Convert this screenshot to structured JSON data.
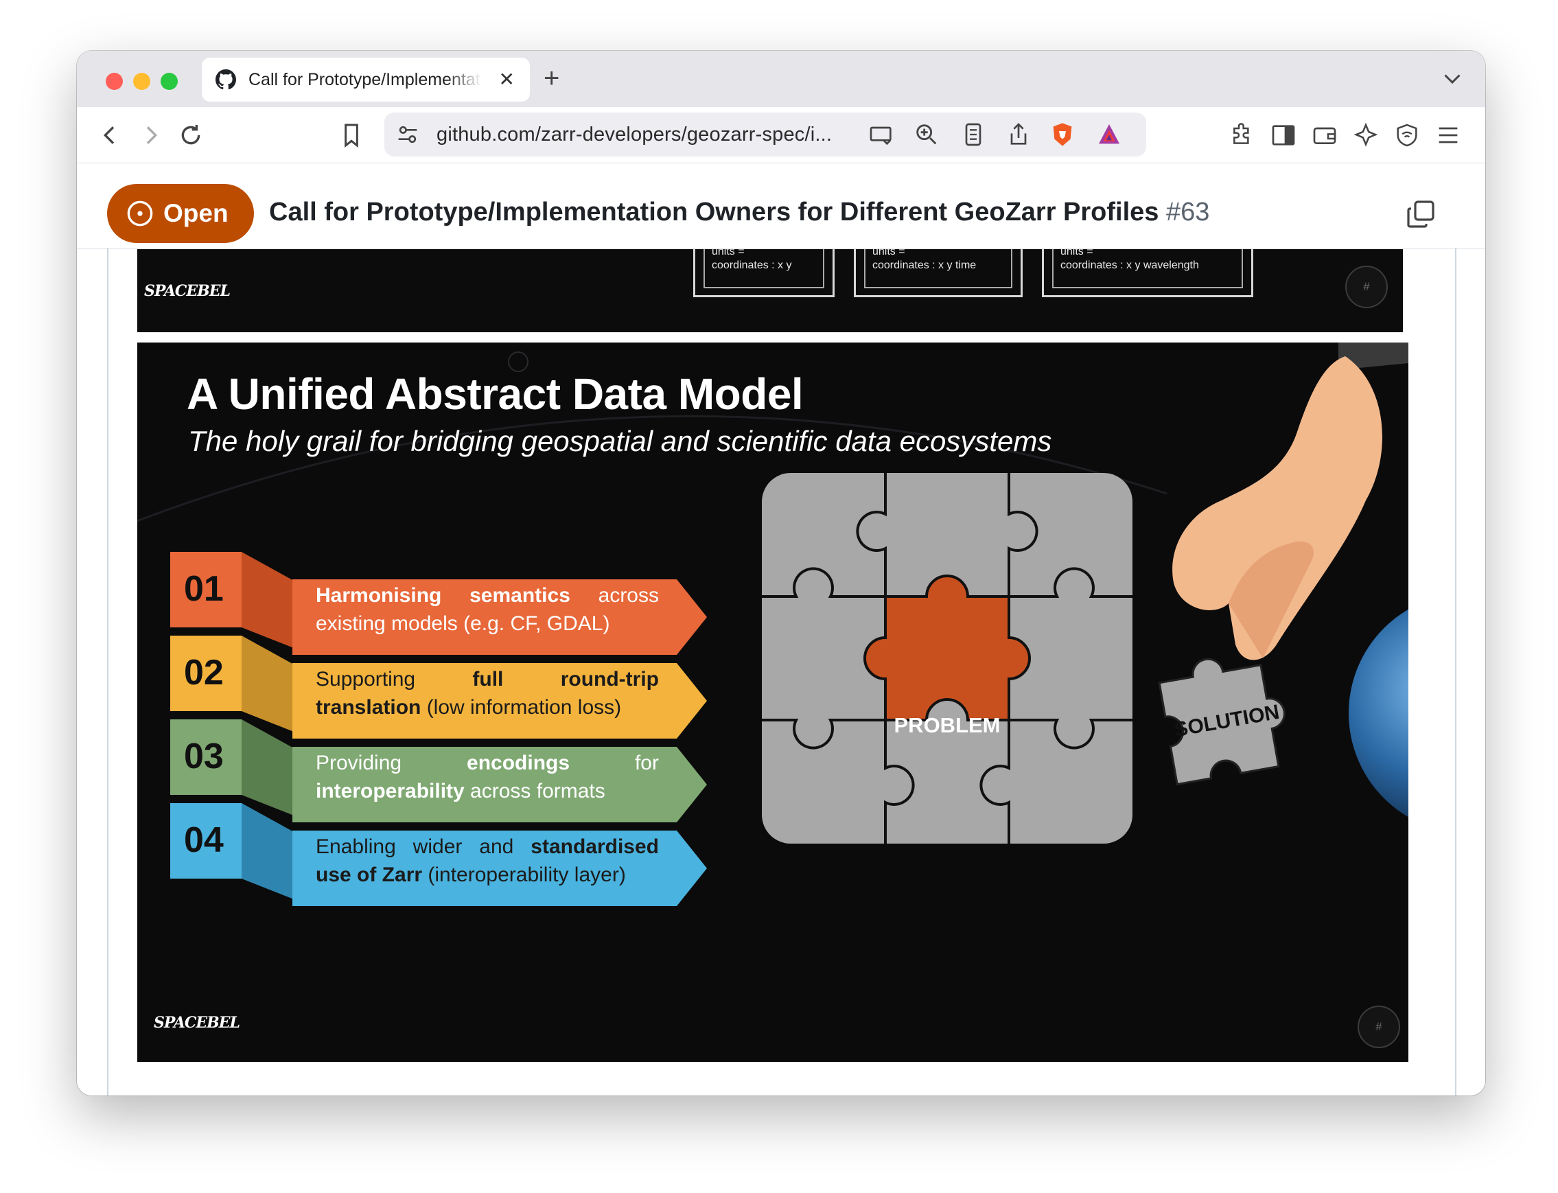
{
  "browser": {
    "tab_title": "Call for Prototype/Implementation Owners for Different GeoZarr Profiles",
    "tab_close": "✕",
    "new_tab": "+",
    "url": "github.com/zarr-developers/geozarr-spec/i...",
    "icons": [
      "back-icon",
      "forward-icon",
      "reload-icon",
      "bookmark-icon",
      "site-settings-icon",
      "cast-icon",
      "zoom-icon",
      "reader-icon",
      "share-icon",
      "brave-shields-icon",
      "brave-rewards-icon",
      "extensions-icon",
      "sidebar-icon",
      "wallet-icon",
      "leo-ai-icon",
      "vpn-icon",
      "menu-icon"
    ]
  },
  "issue": {
    "state": "Open",
    "title": "Call for Prototype/Implementation Owners for Different GeoZarr Profiles",
    "number": "#63"
  },
  "prev_slide": {
    "boxes": [
      {
        "line1": "units =",
        "line2": "coordinates : x y"
      },
      {
        "line1": "units =",
        "line2": "coordinates : x y time"
      },
      {
        "line1": "units =",
        "line2": "coordinates : x y wavelength"
      }
    ],
    "logo": "SPACEBEL",
    "page_num": "#"
  },
  "slide": {
    "title": "A Unified Abstract Data Model",
    "subtitle": "The holy grail for bridging geospatial and scientific data ecosystems",
    "items": [
      {
        "num": "01",
        "bold1": "Harmonising",
        "bold2": "semantics",
        "text1": " across existing models (e.g. CF, GDAL)",
        "color": "#e8683a"
      },
      {
        "num": "02",
        "text0": "Supporting ",
        "bold1": "full",
        "bold2": "round-trip translation",
        "text1": " (low information loss)",
        "color": "#f3b33d"
      },
      {
        "num": "03",
        "text0": "Providing ",
        "bold1": "encodings",
        "text_mid": " for ",
        "bold2": "interoperability",
        "text1": " across formats",
        "color": "#7fa872"
      },
      {
        "num": "04",
        "text0": "Enabling wider and ",
        "bold1": "standardised use of Zarr",
        "text1": " (interoperability layer)",
        "color": "#4ab3df"
      }
    ],
    "puzzle_center": "PROBLEM",
    "puzzle_piece": "SOLUTION",
    "logo": "SPACEBEL",
    "page_num": "#"
  }
}
